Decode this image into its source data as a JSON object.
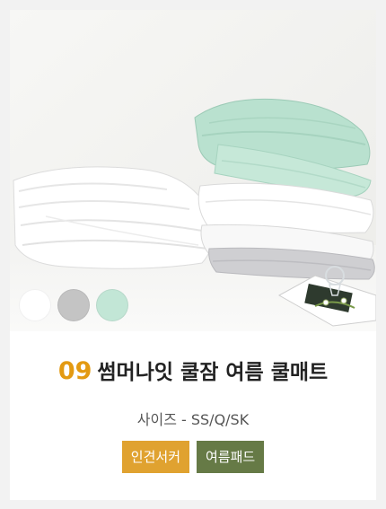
{
  "product": {
    "number": "09",
    "name": "썸머나잇 쿨잠 여름 쿨매트",
    "size_text": "사이즈 - SS/Q/SK"
  },
  "swatches": [
    {
      "color_name": "white",
      "hex": "#ffffff"
    },
    {
      "color_name": "gray",
      "hex": "#c4c4c4"
    },
    {
      "color_name": "mint",
      "hex": "#c2e6d6"
    }
  ],
  "tags": [
    {
      "label": "인견서커",
      "bg": "#e0a230"
    },
    {
      "label": "여름패드",
      "bg": "#667a46"
    }
  ],
  "colors": {
    "page_bg": "#f2f2f2",
    "number_accent": "#e39a12",
    "title": "#222222"
  }
}
